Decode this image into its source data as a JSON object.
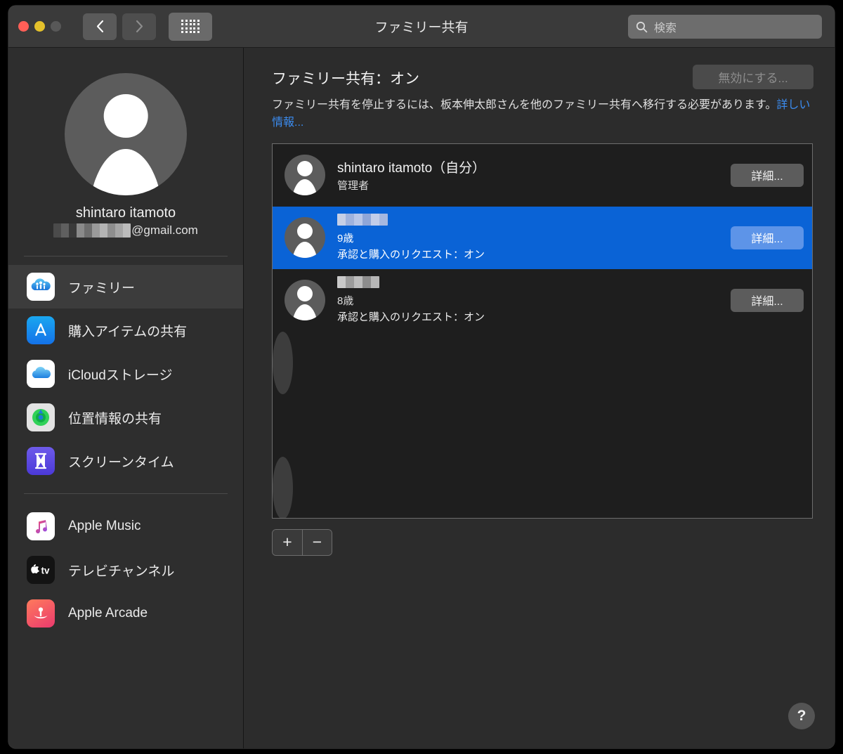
{
  "window": {
    "title": "ファミリー共有",
    "traffic_lights": [
      "close-red",
      "minimize-yellow",
      "zoom-gray-disabled"
    ],
    "nav": {
      "back_icon": "chevron-left-icon",
      "forward_icon": "chevron-right-icon",
      "grid_icon": "show-all-grid-icon"
    }
  },
  "search": {
    "placeholder": "検索",
    "icon": "search-icon",
    "value": ""
  },
  "sidebar": {
    "profile": {
      "avatar_icon": "person-placeholder-avatar",
      "name": "shintaro itamoto",
      "email_suffix": "@gmail.com",
      "email_redacted": true
    },
    "items": [
      {
        "label": "ファミリー",
        "icon": "family-cloud-icon",
        "selected": true
      },
      {
        "label": "購入アイテムの共有",
        "icon": "app-store-icon",
        "selected": false
      },
      {
        "label": "iCloudストレージ",
        "icon": "icloud-icon",
        "selected": false
      },
      {
        "label": "位置情報の共有",
        "icon": "find-my-icon",
        "selected": false
      },
      {
        "label": "スクリーンタイム",
        "icon": "screen-time-icon",
        "selected": false
      }
    ],
    "items2": [
      {
        "label": "Apple Music",
        "icon": "apple-music-icon"
      },
      {
        "label": "テレビチャンネル",
        "icon": "apple-tv-icon"
      },
      {
        "label": "Apple Arcade",
        "icon": "apple-arcade-icon"
      }
    ]
  },
  "main": {
    "title": "ファミリー共有：オン",
    "disable_button": "無効にする...",
    "disable_button_enabled": false,
    "description": "ファミリー共有を停止するには、板本伸太郎さんを他のファミリー共有へ移行する必要があります。",
    "description_link": "詳しい情報...",
    "members": [
      {
        "name": "shintaro itamoto（自分）",
        "name_redacted": false,
        "sub": "管理者",
        "sub2": "",
        "button": "詳細...",
        "selected": false
      },
      {
        "name": "",
        "name_redacted": true,
        "sub": "9歳",
        "sub2": "承認と購入のリクエスト：オン",
        "button": "詳細...",
        "selected": true
      },
      {
        "name": "",
        "name_redacted": true,
        "sub": "8歳",
        "sub2": "承認と購入のリクエスト：オン",
        "button": "詳細...",
        "selected": false
      }
    ],
    "add_button": "+",
    "remove_button": "−",
    "help_button": "?"
  },
  "colors": {
    "accent_blue": "#0a63d6",
    "link_blue": "#3b8cf0",
    "window_bg": "#2c2c2c",
    "sidebar_bg": "#2e2e2e",
    "titlebar_bg": "#3a3a3a",
    "row_light": "#3d3d3d",
    "row_dark": "#1e1e1e"
  }
}
